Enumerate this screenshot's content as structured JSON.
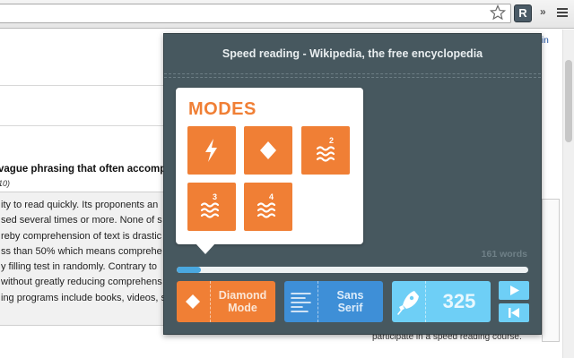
{
  "browser": {
    "extension_icon_letter": "R",
    "overflow_glyph": "»",
    "icons": [
      "star-icon",
      "readability-extension-icon",
      "chrome-menu-icon"
    ]
  },
  "page": {
    "heading_fragment": "vague phrasing that often accompa",
    "subheading_fragment": "10)",
    "paragraph_lines": [
      "ity to read quickly. Its proponents an",
      "sed several times or more. None of s",
      "reby comprehension of text is drastic",
      "ss than 50% which means comprehe",
      "y filling test in randomly. Contrary to",
      "without greatly reducing comprehens",
      "ing programs include books, videos, s"
    ],
    "side_link": "in",
    "side_note": "participate in a speed reading course."
  },
  "popup": {
    "title": "Speed reading - Wikipedia, the free encyclopedia",
    "modes": {
      "heading": "MODES",
      "tiles": [
        {
          "icon": "lightning-icon",
          "badge": ""
        },
        {
          "icon": "diamond-icon",
          "badge": ""
        },
        {
          "icon": "waves-icon",
          "badge": "2"
        },
        {
          "icon": "waves-icon",
          "badge": "3"
        },
        {
          "icon": "waves-icon",
          "badge": "4"
        }
      ]
    },
    "word_count": "161 words",
    "progress": 0.07,
    "mode_button": {
      "line1": "Diamond",
      "line2": "Mode",
      "icon": "diamond-icon"
    },
    "font_button": {
      "line1": "Sans",
      "line2": "Serif",
      "icon": "text-lines-icon"
    },
    "speed_button": {
      "value": "325",
      "icon": "rocket-icon"
    },
    "controls": {
      "play_icon": "play-icon",
      "restart_icon": "skip-back-icon"
    },
    "colors": {
      "panel": "#47585f",
      "orange": "#f07f35",
      "blue": "#3e8fd7",
      "light_blue": "#6ecff6",
      "progress": "#4aa8e0"
    }
  }
}
